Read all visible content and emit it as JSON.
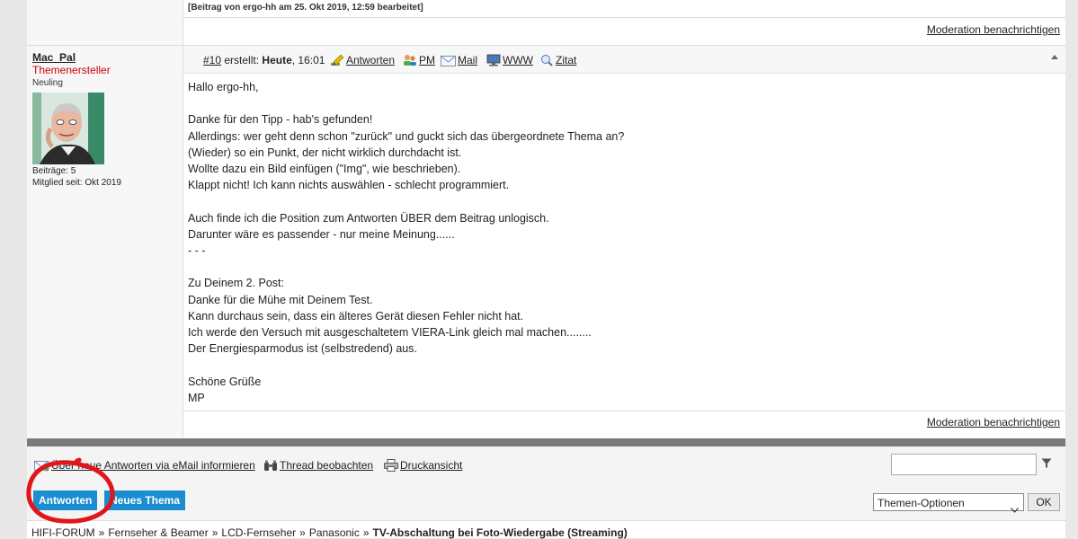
{
  "previous_post": {
    "edit_note": "[Beitrag von ergo-hh am 25. Okt 2019, 12:59 bearbeitet]",
    "moderation_link": "Moderation benachrichtigen"
  },
  "post": {
    "author": {
      "name": "Mac_Pal",
      "role": "Themenersteller",
      "rank": "Neuling",
      "posts": "Beiträge: 5",
      "member_since": "Mitglied seit: Okt 2019"
    },
    "number": "#10",
    "created_label": "erstellt:",
    "date_bold": "Heute",
    "time": ", 16:01",
    "actions": {
      "reply": "Antworten",
      "pm": "PM",
      "mail": "Mail",
      "www": "WWW",
      "quote": "Zitat"
    },
    "body_lines": [
      "Hallo ergo-hh,",
      "",
      "Danke für den Tipp - hab's gefunden!",
      "Allerdings: wer geht denn schon \"zurück\" und guckt sich das übergeordnete Thema an?",
      "(Wieder) so ein Punkt, der nicht wirklich durchdacht ist.",
      "Wollte dazu ein Bild einfügen (\"Img\", wie beschrieben).",
      "Klappt nicht! Ich kann nichts auswählen - schlecht programmiert.",
      "",
      "Auch finde ich die Position zum Antworten ÜBER dem Beitrag unlogisch.",
      "Darunter wäre es passender - nur meine Meinung......",
      "- - -",
      "",
      "Zu Deinem 2. Post:",
      "Danke für die Mühe mit Deinem Test.",
      "Kann durchaus sein, dass ein älteres Gerät diesen Fehler nicht hat.",
      "Ich werde den Versuch mit ausgeschaltetem VIERA-Link gleich mal machen........",
      "Der Energiesparmodus ist (selbstredend) aus.",
      "",
      "Schöne Grüße",
      "MP"
    ],
    "moderation_link": "Moderation benachrichtigen"
  },
  "tools": {
    "subscribe": "Über neue Antworten via eMail informieren",
    "watch": "Thread beobachten",
    "print": "Druckansicht",
    "search_value": ""
  },
  "actions": {
    "reply_button": "Antworten",
    "new_thread_button": "Neues Thema",
    "thread_options": "Themen-Optionen",
    "ok": "OK"
  },
  "breadcrumb": {
    "items": [
      "HIFI-FORUM",
      "Fernseher & Beamer",
      "LCD-Fernseher",
      "Panasonic"
    ],
    "separator": "»",
    "current": "TV-Abschaltung bei Foto-Wiedergabe (Streaming)"
  },
  "colors": {
    "button_blue": "#1a8ed0",
    "role_red": "#c00000",
    "annotation_red": "#e0161b"
  },
  "annotation": {
    "type": "hand-drawn red circle around Antworten button"
  }
}
